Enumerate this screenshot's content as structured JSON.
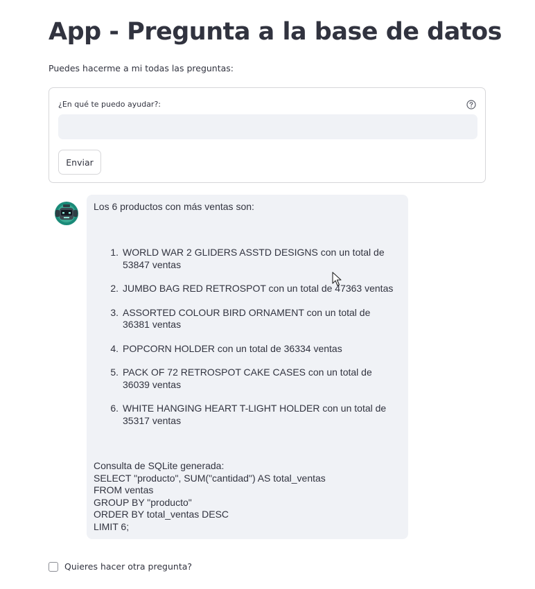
{
  "app": {
    "title": "App - Pregunta a la base de datos",
    "subtitle": "Puedes hacerme a mi todas las preguntas:"
  },
  "form": {
    "label": "¿En qué te puedo ayudar?:",
    "input_value": "",
    "help_icon": "question-circle-icon",
    "submit_label": "Enviar"
  },
  "message": {
    "avatar_icon": "robot-avatar-icon",
    "intro": "Los 6 productos con más ventas son:",
    "items": [
      {
        "num": "1.",
        "line1": "WORLD WAR 2 GLIDERS ASSTD DESIGNS con un total de",
        "line2": "53847 ventas"
      },
      {
        "num": "2.",
        "line1": "JUMBO BAG RED RETROSPOT con un total de 47363 ventas",
        "line2": ""
      },
      {
        "num": "3.",
        "line1": "ASSORTED COLOUR BIRD ORNAMENT con un total de",
        "line2": "36381 ventas"
      },
      {
        "num": "4.",
        "line1": "POPCORN HOLDER con un total de 36334 ventas",
        "line2": ""
      },
      {
        "num": "5.",
        "line1": "PACK OF 72 RETROSPOT CAKE CASES con un total de",
        "line2": "36039 ventas"
      },
      {
        "num": "6.",
        "line1": "WHITE HANGING HEART T-LIGHT HOLDER con un total de",
        "line2": "35317 ventas"
      }
    ],
    "sql_lines": [
      "Consulta de SQLite generada:",
      "SELECT \"producto\", SUM(\"cantidad\") AS total_ventas",
      "FROM ventas",
      "GROUP BY \"producto\"",
      "ORDER BY total_ventas DESC",
      "LIMIT 6;"
    ]
  },
  "checkbox": {
    "label": "Quieres hacer otra pregunta?",
    "checked": false
  },
  "colors": {
    "text": "#31333f",
    "input_bg": "#f0f2f6",
    "border": "#d6d6d9",
    "avatar_teal": "#1a8a78"
  }
}
